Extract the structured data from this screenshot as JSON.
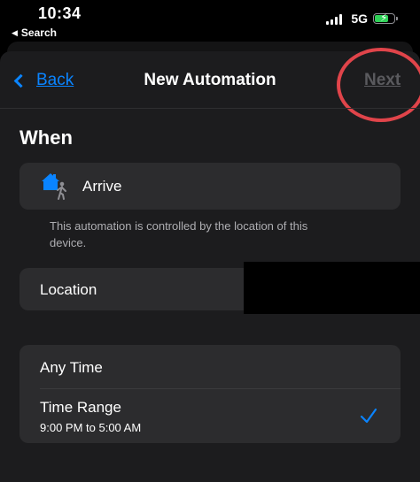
{
  "status_bar": {
    "time": "10:34",
    "back_app_label": "Search",
    "network": "5G"
  },
  "nav": {
    "back_label": "Back",
    "title": "New Automation",
    "next_label": "Next"
  },
  "section": {
    "title": "When"
  },
  "trigger": {
    "label": "Arrive",
    "icon": "home-arrive-icon"
  },
  "note": "This automation is controlled by the location of this device.",
  "location": {
    "label": "Location"
  },
  "time_options": {
    "any_time": "Any Time",
    "time_range": "Time Range",
    "time_range_value": "9:00 PM to 5:00 AM",
    "selected": "time_range"
  },
  "colors": {
    "accent": "#0a84ff",
    "annotation": "#e0444a",
    "battery": "#30d158",
    "disabled": "#5a5a5e"
  }
}
